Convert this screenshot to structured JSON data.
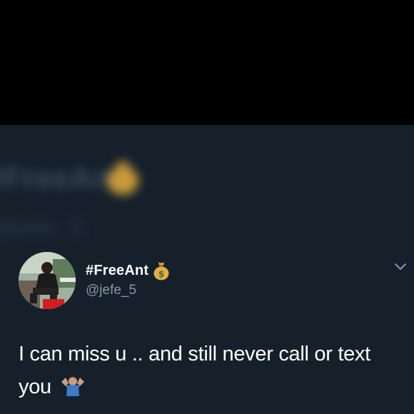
{
  "background": {
    "top": "#000000",
    "panel": "#15202b"
  },
  "blurred_header": {
    "name": "#FreeAnt",
    "handle": "@jefe_5",
    "icon": "money-bag-icon"
  },
  "tweet": {
    "display_name": "#FreeAnt",
    "name_icon": "money-bag-icon",
    "handle": "@jefe_5",
    "menu_icon": "chevron-down-icon",
    "text": "I can miss u .. and still never call or text you",
    "text_emoji": "shrug-emoji-icon",
    "colors": {
      "name": "#ffffff",
      "handle": "#8899a6",
      "text": "#ffffff"
    }
  }
}
